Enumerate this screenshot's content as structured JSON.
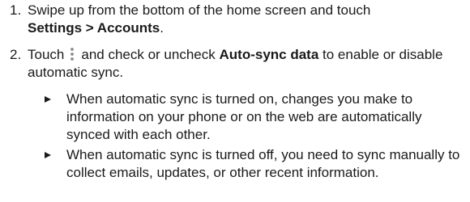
{
  "steps": [
    {
      "number": "1.",
      "text_a": "Swipe up from the bottom of the home screen and touch",
      "bold_a": "Settings > Accounts",
      "text_b": "."
    },
    {
      "number": "2.",
      "text_a": "Touch",
      "icon": "more-options-icon",
      "text_b": "and check or uncheck",
      "bold_a": "Auto-sync data",
      "text_c": "to enable or disable automatic sync."
    }
  ],
  "bullets": [
    {
      "marker": "triangle-bullet-icon",
      "text": "When automatic sync is turned on, changes you make to information on your phone or on the web are automatically synced with each other."
    },
    {
      "marker": "triangle-bullet-icon",
      "text": "When automatic sync is turned off, you need to sync manually to collect emails, updates, or other recent information."
    }
  ],
  "colors": {
    "text": "#1a1a1a",
    "icon": "#8a8a8a"
  }
}
